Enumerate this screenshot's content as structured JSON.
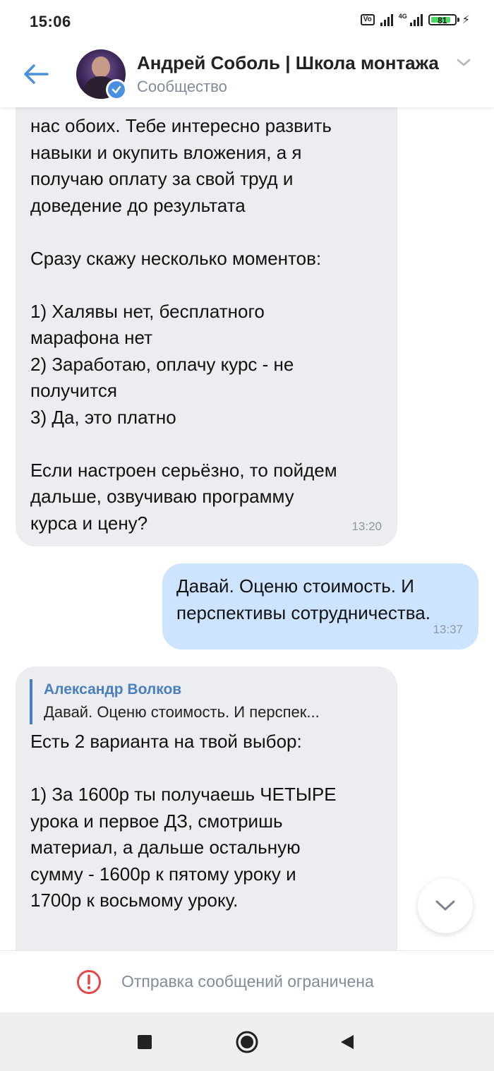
{
  "status_bar": {
    "time": "15:06",
    "volte": "Vo LTE",
    "network": "4G",
    "battery": "81"
  },
  "header": {
    "title": "Андрей Соболь | Школа монтажа",
    "subtitle": "Сообщество",
    "accent_color": "#4a90e2"
  },
  "messages": [
    {
      "direction": "incoming",
      "text": "нас обоих. Тебе интересно развить\nнавыки и окупить вложения, а я\nполучаю оплату за свой труд и\nдоведение до результата\n\nСразу скажу несколько моментов:\n\n1) Халявы нет, бесплатного\nмарафона нет\n2) Заработаю, оплачу курс - не\nполучится\n3) Да, это платно\n\nЕсли настроен серьёзно, то пойдем\nдальше, озвучиваю программу\nкурса и цену?",
      "time": "13:20"
    },
    {
      "direction": "outgoing",
      "text": "Давай. Оценю стоимость. И\nперспективы сотрудничества.",
      "time": "13:37"
    },
    {
      "direction": "incoming",
      "reply_author": "Александр Волков",
      "reply_text": "Давай. Оценю стоимость. И перспек...",
      "text": "Есть 2 варианта на твой выбор:\n\n1) За 1600р ты получаешь ЧЕТЫРЕ\nурока и первое ДЗ, смотришь\nматериал, а дальше остальную\nсумму - 1600р к пятому уроку и\n1700р к восьмому уроку.",
      "time": ""
    }
  ],
  "restriction": {
    "text": "Отправка сообщений ограничена",
    "icon": "alert-circle-icon",
    "icon_color": "#e64646"
  },
  "nav": {
    "icons": [
      "recent-apps-icon",
      "home-icon",
      "back-icon"
    ]
  }
}
